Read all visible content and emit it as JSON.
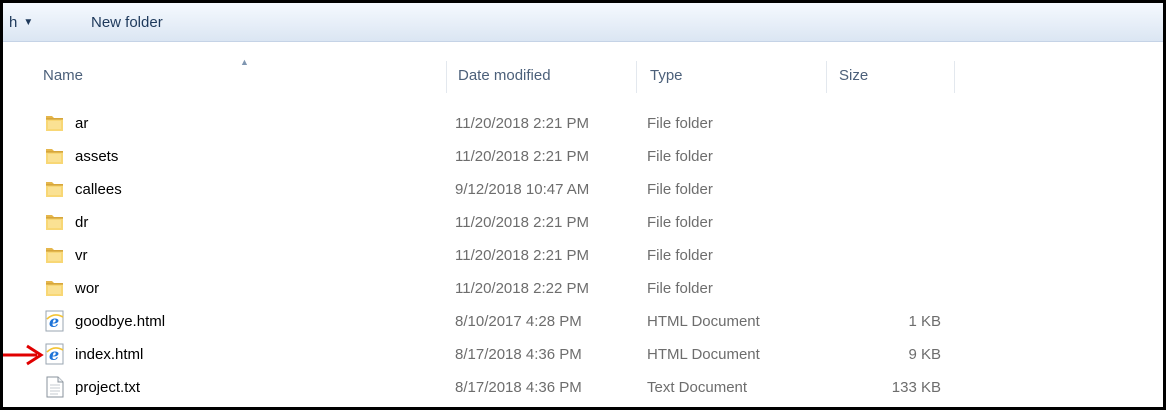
{
  "toolbar": {
    "cut_label": "h",
    "dropdown_glyph": "▼",
    "new_folder_label": "New folder"
  },
  "columns": {
    "name": "Name",
    "date": "Date modified",
    "type": "Type",
    "size": "Size",
    "sort_glyph": "▲"
  },
  "files": [
    {
      "name": "ar",
      "date": "11/20/2018 2:21 PM",
      "type": "File folder",
      "size": "",
      "icon": "folder-icon"
    },
    {
      "name": "assets",
      "date": "11/20/2018 2:21 PM",
      "type": "File folder",
      "size": "",
      "icon": "folder-icon"
    },
    {
      "name": "callees",
      "date": "9/12/2018 10:47 AM",
      "type": "File folder",
      "size": "",
      "icon": "folder-icon"
    },
    {
      "name": "dr",
      "date": "11/20/2018 2:21 PM",
      "type": "File folder",
      "size": "",
      "icon": "folder-icon"
    },
    {
      "name": "vr",
      "date": "11/20/2018 2:21 PM",
      "type": "File folder",
      "size": "",
      "icon": "folder-icon"
    },
    {
      "name": "wor",
      "date": "11/20/2018 2:22 PM",
      "type": "File folder",
      "size": "",
      "icon": "folder-icon"
    },
    {
      "name": "goodbye.html",
      "date": "8/10/2017 4:28 PM",
      "type": "HTML Document",
      "size": "1 KB",
      "icon": "internet-explorer-icon"
    },
    {
      "name": "index.html",
      "date": "8/17/2018 4:36 PM",
      "type": "HTML Document",
      "size": "9 KB",
      "icon": "internet-explorer-icon"
    },
    {
      "name": "project.txt",
      "date": "8/17/2018 4:36 PM",
      "type": "Text Document",
      "size": "133 KB",
      "icon": "text-document-icon"
    }
  ],
  "annotation": {
    "arrow_color": "#e00000",
    "points_to": "index.html"
  }
}
